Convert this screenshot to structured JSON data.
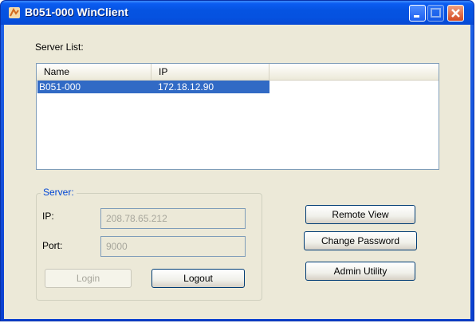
{
  "window": {
    "title": "B051-000 WinClient"
  },
  "server_list": {
    "label": "Server List:",
    "columns": [
      "Name",
      "IP"
    ],
    "rows": [
      {
        "name": "B051-000",
        "ip": "172.18.12.90",
        "selected": true
      }
    ]
  },
  "server_group": {
    "label": "Server:",
    "ip_label": "IP:",
    "ip_value": "208.78.65.212",
    "port_label": "Port:",
    "port_value": "9000"
  },
  "buttons": {
    "login": "Login",
    "logout": "Logout",
    "remote_view": "Remote View",
    "change_password": "Change Password",
    "admin_utility": "Admin Utility"
  },
  "colors": {
    "selection": "#316ac5",
    "titlebar": "#0553e1",
    "group_label": "#0046d5"
  }
}
